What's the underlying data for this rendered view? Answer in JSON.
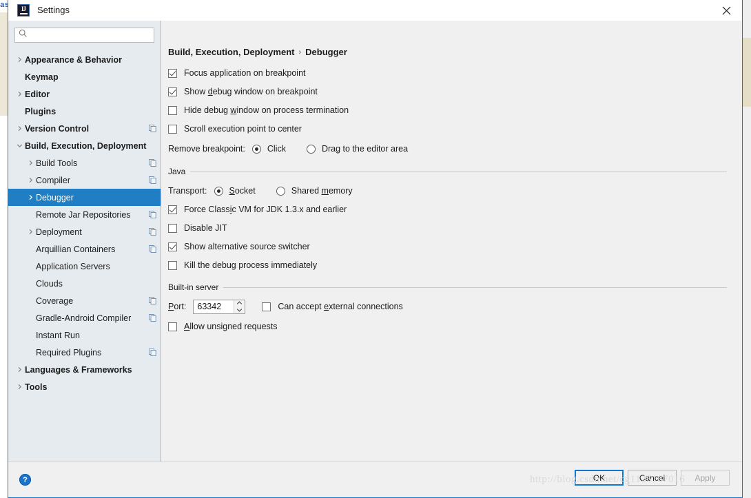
{
  "window": {
    "title": "Settings",
    "icon": "intellij-logo-icon",
    "close_icon": "close-icon",
    "border_color": "#1176cf"
  },
  "background_fragments": {
    "left_text": "as"
  },
  "search": {
    "value": "",
    "placeholder": "",
    "icon": "search-icon"
  },
  "sidebar": {
    "items": [
      {
        "label": "Appearance & Behavior",
        "level": 0,
        "arrow": "right",
        "bold": true,
        "copy": false,
        "selected": false
      },
      {
        "label": "Keymap",
        "level": 0,
        "arrow": "none",
        "bold": true,
        "copy": false,
        "selected": false
      },
      {
        "label": "Editor",
        "level": 0,
        "arrow": "right",
        "bold": true,
        "copy": false,
        "selected": false
      },
      {
        "label": "Plugins",
        "level": 0,
        "arrow": "none",
        "bold": true,
        "copy": false,
        "selected": false
      },
      {
        "label": "Version Control",
        "level": 0,
        "arrow": "right",
        "bold": true,
        "copy": true,
        "selected": false
      },
      {
        "label": "Build, Execution, Deployment",
        "level": 0,
        "arrow": "down",
        "bold": true,
        "copy": false,
        "selected": false
      },
      {
        "label": "Build Tools",
        "level": 1,
        "arrow": "right",
        "bold": false,
        "copy": true,
        "selected": false
      },
      {
        "label": "Compiler",
        "level": 1,
        "arrow": "right",
        "bold": false,
        "copy": true,
        "selected": false
      },
      {
        "label": "Debugger",
        "level": 1,
        "arrow": "right",
        "bold": false,
        "copy": false,
        "selected": true
      },
      {
        "label": "Remote Jar Repositories",
        "level": 1,
        "arrow": "none",
        "bold": false,
        "copy": true,
        "selected": false
      },
      {
        "label": "Deployment",
        "level": 1,
        "arrow": "right",
        "bold": false,
        "copy": true,
        "selected": false
      },
      {
        "label": "Arquillian Containers",
        "level": 1,
        "arrow": "none",
        "bold": false,
        "copy": true,
        "selected": false
      },
      {
        "label": "Application Servers",
        "level": 1,
        "arrow": "none",
        "bold": false,
        "copy": false,
        "selected": false
      },
      {
        "label": "Clouds",
        "level": 1,
        "arrow": "none",
        "bold": false,
        "copy": false,
        "selected": false
      },
      {
        "label": "Coverage",
        "level": 1,
        "arrow": "none",
        "bold": false,
        "copy": true,
        "selected": false
      },
      {
        "label": "Gradle-Android Compiler",
        "level": 1,
        "arrow": "none",
        "bold": false,
        "copy": true,
        "selected": false
      },
      {
        "label": "Instant Run",
        "level": 1,
        "arrow": "none",
        "bold": false,
        "copy": false,
        "selected": false
      },
      {
        "label": "Required Plugins",
        "level": 1,
        "arrow": "none",
        "bold": false,
        "copy": true,
        "selected": false
      },
      {
        "label": "Languages & Frameworks",
        "level": 0,
        "arrow": "right",
        "bold": true,
        "copy": false,
        "selected": false
      },
      {
        "label": "Tools",
        "level": 0,
        "arrow": "right",
        "bold": true,
        "copy": false,
        "selected": false
      }
    ],
    "selection_color": "#1f7ec4"
  },
  "content": {
    "breadcrumb": {
      "parent": "Build, Execution, Deployment",
      "separator": "›",
      "current": "Debugger"
    },
    "top_checkboxes": [
      {
        "label_pre": "Focus application on breakpoint",
        "mnemonic": "",
        "label_post": "",
        "checked": true
      },
      {
        "label_pre": "Show ",
        "mnemonic": "d",
        "label_post": "ebug window on breakpoint",
        "checked": true
      },
      {
        "label_pre": "Hide debug ",
        "mnemonic": "w",
        "label_post": "indow on process termination",
        "checked": false
      },
      {
        "label_pre": "Scroll execution point to center",
        "mnemonic": "",
        "label_post": "",
        "checked": false
      }
    ],
    "remove_breakpoint": {
      "label": "Remove breakpoint:",
      "options": [
        {
          "label_pre": "Click",
          "mnemonic": "",
          "label_post": "",
          "selected": true
        },
        {
          "label_pre": "Drag to the editor area",
          "mnemonic": "",
          "label_post": "",
          "selected": false
        }
      ]
    },
    "java_group": {
      "title": "Java",
      "transport": {
        "label": "Transport:",
        "options": [
          {
            "label_pre": "",
            "mnemonic": "S",
            "label_post": "ocket",
            "selected": true
          },
          {
            "label_pre": "Shared ",
            "mnemonic": "m",
            "label_post": "emory",
            "selected": false
          }
        ]
      },
      "checkboxes": [
        {
          "label_pre": "Force Class",
          "mnemonic": "i",
          "label_post": "c VM for JDK 1.3.x and earlier",
          "checked": true
        },
        {
          "label_pre": "Disable JIT",
          "mnemonic": "",
          "label_post": "",
          "checked": false
        },
        {
          "label_pre": "Show alternative source switcher",
          "mnemonic": "",
          "label_post": "",
          "checked": true
        },
        {
          "label_pre": "Kill the debug process immediately",
          "mnemonic": "",
          "label_post": "",
          "checked": false
        }
      ]
    },
    "builtin_server": {
      "title": "Built-in server",
      "port_label_pre": "",
      "port_mnemonic": "P",
      "port_label_post": "ort:",
      "port_value": "63342",
      "external_connections": {
        "label_pre": "Can accept ",
        "mnemonic": "e",
        "label_post": "xternal connections",
        "checked": false
      },
      "unsigned_requests": {
        "label_pre": "",
        "mnemonic": "A",
        "label_post": "llow unsigned requests",
        "checked": false
      }
    }
  },
  "footer": {
    "help_label": "?",
    "buttons": [
      {
        "label": "OK",
        "state": "default"
      },
      {
        "label": "Cancel",
        "state": "normal"
      },
      {
        "label": "Apply",
        "state": "disabled"
      }
    ]
  },
  "watermark": "http://blog.csdn.net/cg1125167016"
}
